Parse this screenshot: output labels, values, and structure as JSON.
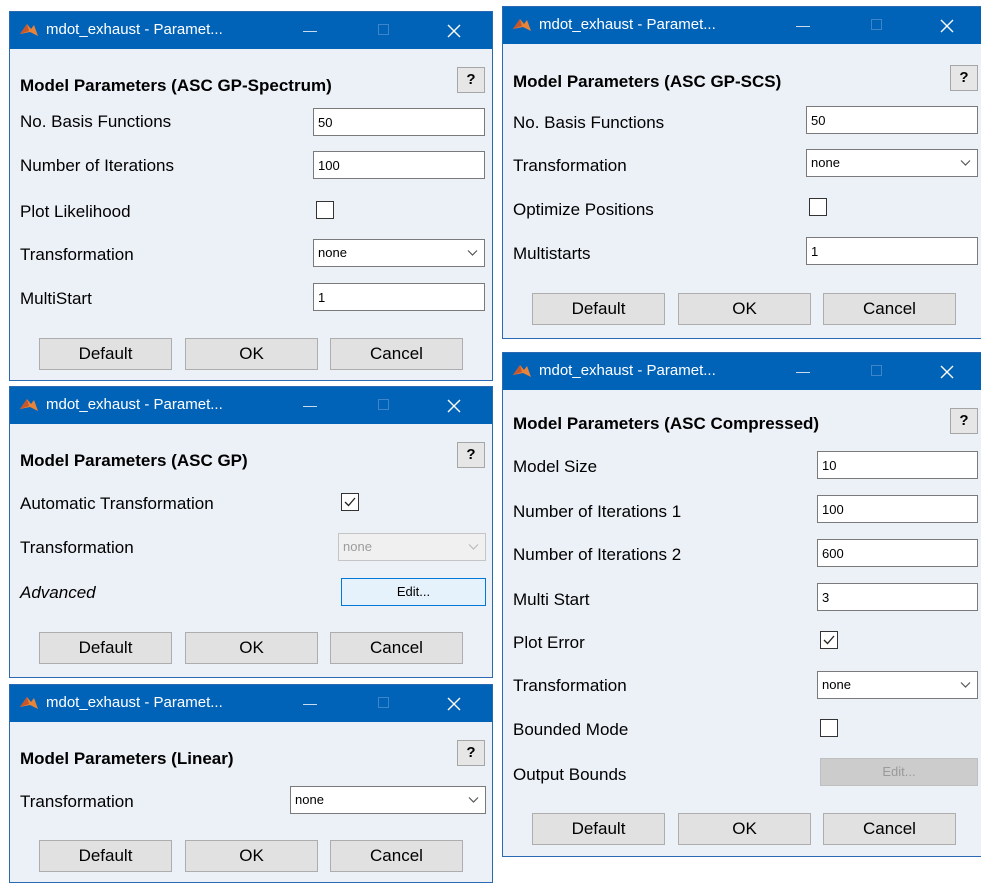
{
  "window_title": "mdot_exhaust - Paramet...",
  "icons": {
    "app": "matlab-icon",
    "minimize": "minimize-icon",
    "maximize": "maximize-icon",
    "close": "close-icon"
  },
  "colors": {
    "titlebar": "#0163b8",
    "dialog_bg": "#ecf0f7"
  },
  "buttons": {
    "default": "Default",
    "ok": "OK",
    "cancel": "Cancel"
  },
  "help": "?",
  "spectrum": {
    "header": "Model Parameters (ASC GP-Spectrum)",
    "basis_label": "No. Basis Functions",
    "basis_value": "50",
    "iterations_label": "Number of Iterations",
    "iterations_value": "100",
    "plot_label": "Plot Likelihood",
    "plot_checked": false,
    "transform_label": "Transformation",
    "transform_value": "none",
    "multistart_label": "MultiStart",
    "multistart_value": "1"
  },
  "gp": {
    "header": "Model Parameters (ASC GP)",
    "auto_label": "Automatic Transformation",
    "auto_checked": true,
    "transform_label": "Transformation",
    "transform_value": "none",
    "advanced_label": "Advanced",
    "edit_label": "Edit..."
  },
  "linear": {
    "header": "Model Parameters (Linear)",
    "transform_label": "Transformation",
    "transform_value": "none"
  },
  "scs": {
    "header": "Model Parameters (ASC GP-SCS)",
    "basis_label": "No. Basis Functions",
    "basis_value": "50",
    "transform_label": "Transformation",
    "transform_value": "none",
    "optimize_label": "Optimize Positions",
    "optimize_checked": false,
    "multistarts_label": "Multistarts",
    "multistarts_value": "1"
  },
  "compressed": {
    "header": "Model Parameters (ASC Compressed)",
    "size_label": "Model Size",
    "size_value": "10",
    "iter1_label": "Number of Iterations 1",
    "iter1_value": "100",
    "iter2_label": "Number of Iterations 2",
    "iter2_value": "600",
    "multistart_label": "Multi Start",
    "multistart_value": "3",
    "plot_label": "Plot Error",
    "plot_checked": true,
    "transform_label": "Transformation",
    "transform_value": "none",
    "bounded_label": "Bounded Mode",
    "bounded_checked": false,
    "bounds_label": "Output Bounds",
    "edit_label": "Edit..."
  }
}
